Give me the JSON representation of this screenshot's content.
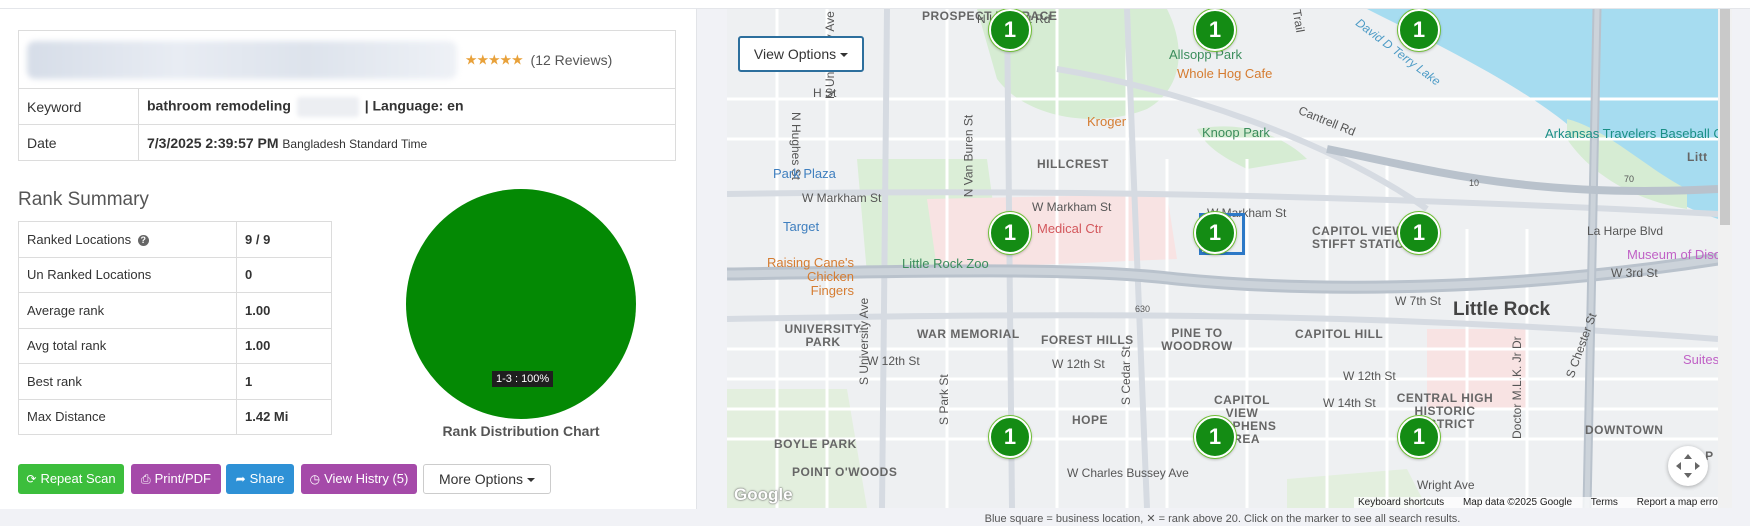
{
  "header": {
    "stars": "★★★★★",
    "reviews": "(12 Reviews)"
  },
  "info": {
    "keyword_label": "Keyword",
    "keyword_value": "bathroom remodeling",
    "language": "| Language: en",
    "date_label": "Date",
    "date_value": "7/3/2025 2:39:57 PM",
    "timezone": "Bangladesh Standard Time"
  },
  "rank_summary": {
    "title": "Rank Summary",
    "rows": [
      {
        "label": "Ranked Locations",
        "value": "9 / 9"
      },
      {
        "label": "Un Ranked Locations",
        "value": "0"
      },
      {
        "label": "Average rank",
        "value": "1.00"
      },
      {
        "label": "Avg total rank",
        "value": "1.00"
      },
      {
        "label": "Best rank",
        "value": "1"
      },
      {
        "label": "Max Distance",
        "value": "1.42 Mi"
      }
    ],
    "help_icon": "question-circle-icon"
  },
  "chart_data": {
    "type": "pie",
    "title": "Rank Distribution Chart",
    "categories": [
      "1-3"
    ],
    "values": [
      100
    ],
    "labels": [
      "1-3 : 100%"
    ],
    "colors": [
      "#048904"
    ]
  },
  "buttons": {
    "repeat": "Repeat Scan",
    "print": "Print/PDF",
    "share": "Share",
    "history": "View Histry (5)",
    "more": "More Options"
  },
  "map": {
    "view_options": "View Options",
    "markers": [
      "1",
      "1",
      "1",
      "1",
      "1",
      "1",
      "1",
      "1",
      "1"
    ],
    "marker_color": "#148c14",
    "business_box_color": "#2d79c7",
    "labels": {
      "prospect_terrace": "PROSPECT TERRACE",
      "lookout": "N Lookout Rd",
      "allsopp": "Allsopp Park",
      "whole_hog": "Whole Hog Cafe",
      "david_lake": "David D Terry Lake",
      "trail": "Trail",
      "h_st": "H St",
      "kroger": "Kroger",
      "cantrell": "Cantrell Rd",
      "knoop": "Knoop Park",
      "arkansas_travelers": "Arkansas Travelers Baseball Club",
      "lit": "Litt",
      "n_university": "N University Ave",
      "n_hughes": "N Hughes St",
      "n_van_buren": "N Van Buren St",
      "park_plaza": "Park Plaza",
      "hillcrest": "HILLCREST",
      "w_markham_left": "W Markham St",
      "w_markham_mid": "W Markham St",
      "w_markham_right": "W Markham St",
      "target": "Target",
      "medical": "Medical Ctr",
      "capitol_view": "CAPITOL VIEW - STIFFT STATION",
      "la_harpe": "La Harpe Blvd",
      "museum": "Museum of Disc",
      "w_3rd": "W 3rd St",
      "raising_cane": "Raising Cane's Chicken Fingers",
      "zoo": "Little Rock Zoo",
      "w_7th": "W 7th St",
      "little_rock": "Little Rock",
      "i630": "630",
      "university_park": "UNIVERSITY PARK",
      "war_memorial": "WAR MEMORIAL",
      "forest_hills": "FOREST HILLS",
      "pine_to_woodrow": "PINE TO WOODROW",
      "capitol_hill": "CAPITOL HILL",
      "w_12th_left": "W 12th St",
      "w_12th_mid": "W 12th St",
      "w_12th_right": "W 12th St",
      "s_university": "S University Ave",
      "s_park": "S Park St",
      "s_cedar": "S Cedar St",
      "capitol_view_stephens": "CAPITOL VIEW STEPHENS AREA",
      "w_14th": "W 14th St",
      "central_high": "CENTRAL HIGH HISTORIC DISTRICT",
      "mlk": "Doctor M.L.K. Jr Dr",
      "chester": "S Chester St",
      "downtown": "DOWNTOWN",
      "suites": "Suites",
      "hope": "HOPE",
      "boyle_park": "BOYLE PARK",
      "point_owoods": "POINT O'WOODS",
      "charles_bussey": "W Charles Bussey Ave",
      "wright": "Wright Ave",
      "quapaw": "QUAP",
      "r10": "10",
      "r70": "70"
    },
    "google_logo": "Google",
    "footer": {
      "shortcuts": "Keyboard shortcuts",
      "mapdata": "Map data ©2025 Google",
      "terms": "Terms",
      "report": "Report a map error"
    }
  },
  "legend_note": "Blue square = business location, ✕ = rank above 20. Click on the marker to see all search results."
}
